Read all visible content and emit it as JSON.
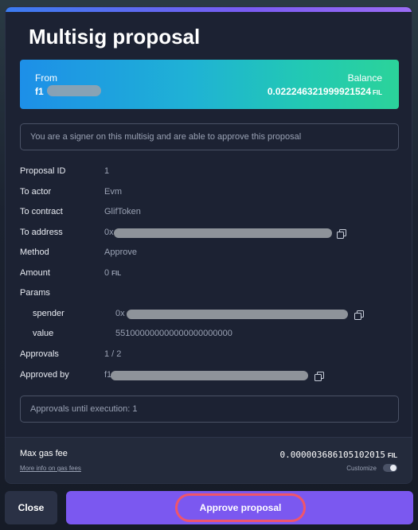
{
  "title": "Multisig proposal",
  "balance_card": {
    "from_label": "From",
    "from_value": "f1",
    "balance_label": "Balance",
    "balance_value": "0.022246321999921524",
    "balance_unit": "FIL",
    "gradient": [
      "#1d8fe8",
      "#2bd39a"
    ]
  },
  "signer_notice": "You are a signer on this multisig and are able to approve this proposal",
  "details": {
    "proposal_id": {
      "label": "Proposal ID",
      "value": "1"
    },
    "to_actor": {
      "label": "To actor",
      "value": "Evm"
    },
    "to_contract": {
      "label": "To contract",
      "value": "GlifToken"
    },
    "to_address": {
      "label": "To address",
      "value": "0x"
    },
    "method": {
      "label": "Method",
      "value": "Approve"
    },
    "amount": {
      "label": "Amount",
      "value": "0",
      "unit": "FIL"
    },
    "params": {
      "label": "Params",
      "spender": {
        "label": "spender",
        "value": "0x"
      },
      "value": {
        "label": "value",
        "value": "551000000000000000000000"
      }
    },
    "approvals": {
      "label": "Approvals",
      "value": "1 / 2"
    },
    "approved_by": {
      "label": "Approved by",
      "value": "f1"
    }
  },
  "execution_notice": "Approvals until execution: 1",
  "gas": {
    "label": "Max gas fee",
    "link": "More info on gas fees",
    "value": "0.000003686105102015",
    "unit": "FIL",
    "customize_label": "Customize"
  },
  "buttons": {
    "close": "Close",
    "approve": "Approve proposal"
  },
  "colors": {
    "accent": "#7b58f0",
    "highlight_ring": "#f0556a",
    "modal_bg": "#1c2233"
  }
}
